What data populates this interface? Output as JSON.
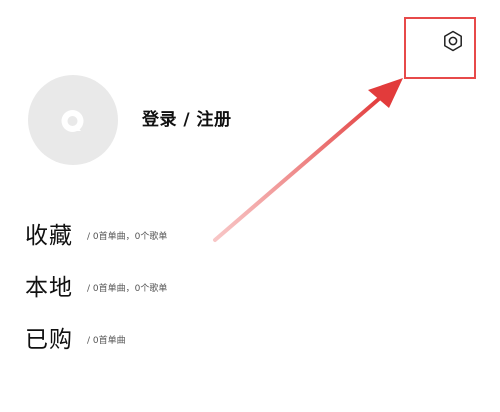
{
  "settings": {
    "icon": "gear-icon",
    "highlight_color": "#e74a4a"
  },
  "profile": {
    "avatar_icon": "music-logo-icon",
    "login_label": "登录 / 注册"
  },
  "library": [
    {
      "label": "收藏",
      "detail": "/ 0首单曲，0个歌单"
    },
    {
      "label": "本地",
      "detail": "/ 0首单曲，0个歌单"
    },
    {
      "label": "已购",
      "detail": "/ 0首单曲"
    }
  ],
  "annotation": {
    "arrow_color": "#e74a4a"
  }
}
